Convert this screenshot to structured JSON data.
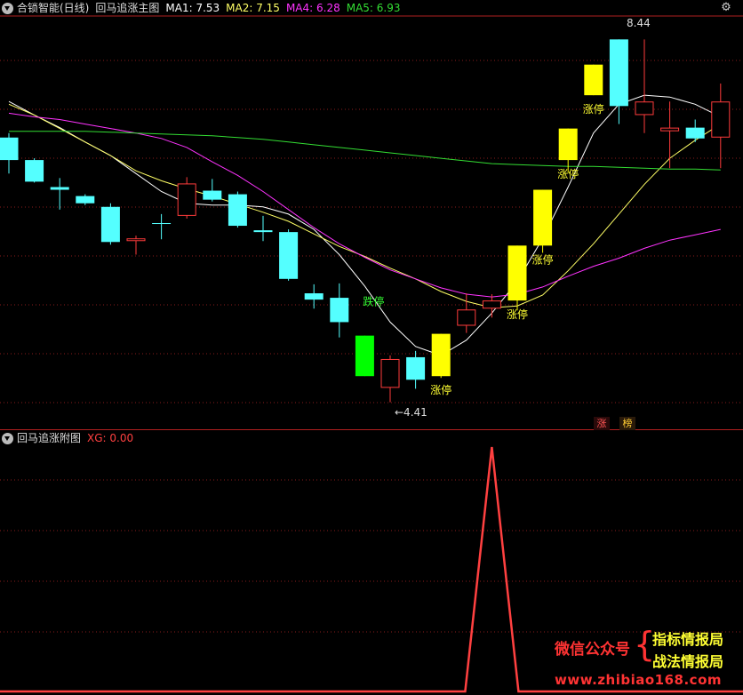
{
  "main_header": {
    "title": "合锁智能(日线)",
    "indicator_name": "回马追涨主图",
    "ma1_label": "MA1: 7.53",
    "ma2_label": "MA2: 7.15",
    "ma4_label": "MA4: 6.28",
    "ma5_label": "MA5: 6.93"
  },
  "sub_header": {
    "indicator_name": "回马追涨附图",
    "xg_label": "XG: 0.00"
  },
  "badges": {
    "zhang": "涨",
    "bang": "榜"
  },
  "watermark": {
    "wechat": "微信公众号",
    "brace": "{",
    "line1": "指标情报局",
    "line2": "战法情报局",
    "site": "www.zhibiao168.com"
  },
  "icons": {
    "settings": "gear-icon",
    "collapse": "chevron-down-icon"
  },
  "colors": {
    "up": "#ff3b3b",
    "down": "#54ffff",
    "limit_up": "#ffff00",
    "limit_down": "#00ff00",
    "ma1": "#ffffff",
    "ma2": "#ffff66",
    "ma4": "#ff33ff",
    "ma5": "#33dd33",
    "grid": "#8a1c1c",
    "xg": "#ff4040"
  },
  "chart_data": [
    {
      "type": "candlestick",
      "title": "回马追涨主图",
      "ylim": [
        4.1,
        8.7
      ],
      "max_label": "8.44",
      "min_label": "←4.41",
      "candles": [
        {
          "o": 7.35,
          "h": 7.4,
          "l": 6.95,
          "c": 7.1,
          "kind": "down"
        },
        {
          "o": 7.1,
          "h": 7.12,
          "l": 6.85,
          "c": 6.86,
          "kind": "down"
        },
        {
          "o": 6.8,
          "h": 6.9,
          "l": 6.55,
          "c": 6.77,
          "kind": "down"
        },
        {
          "o": 6.7,
          "h": 6.72,
          "l": 6.6,
          "c": 6.62,
          "kind": "down"
        },
        {
          "o": 6.58,
          "h": 6.62,
          "l": 6.16,
          "c": 6.19,
          "kind": "down"
        },
        {
          "o": 6.2,
          "h": 6.26,
          "l": 6.05,
          "c": 6.23,
          "kind": "up"
        },
        {
          "o": 6.4,
          "h": 6.5,
          "l": 6.22,
          "c": 6.39,
          "kind": "down"
        },
        {
          "o": 6.48,
          "h": 6.91,
          "l": 6.45,
          "c": 6.84,
          "kind": "up"
        },
        {
          "o": 6.76,
          "h": 6.89,
          "l": 6.64,
          "c": 6.66,
          "kind": "down"
        },
        {
          "o": 6.72,
          "h": 6.75,
          "l": 6.35,
          "c": 6.37,
          "kind": "down"
        },
        {
          "o": 6.32,
          "h": 6.48,
          "l": 6.2,
          "c": 6.3,
          "kind": "down"
        },
        {
          "o": 6.3,
          "h": 6.33,
          "l": 5.76,
          "c": 5.78,
          "kind": "down"
        },
        {
          "o": 5.62,
          "h": 5.72,
          "l": 5.45,
          "c": 5.55,
          "kind": "down"
        },
        {
          "o": 5.57,
          "h": 5.73,
          "l": 5.13,
          "c": 5.3,
          "kind": "down"
        },
        {
          "o": 5.15,
          "h": 5.15,
          "l": 4.7,
          "c": 4.7,
          "kind": "limit_down",
          "label": "跌停"
        },
        {
          "o": 4.89,
          "h": 4.93,
          "l": 4.41,
          "c": 4.57,
          "kind": "up"
        },
        {
          "o": 4.66,
          "h": 4.98,
          "l": 4.56,
          "c": 4.91,
          "kind": "down"
        },
        {
          "o": 4.7,
          "h": 5.17,
          "l": 4.68,
          "c": 5.17,
          "kind": "limit_up",
          "label": "涨停"
        },
        {
          "o": 5.26,
          "h": 5.62,
          "l": 5.18,
          "c": 5.44,
          "kind": "up"
        },
        {
          "o": 5.45,
          "h": 5.61,
          "l": 5.35,
          "c": 5.54,
          "kind": "up"
        },
        {
          "o": 5.54,
          "h": 6.15,
          "l": 5.43,
          "c": 6.15,
          "kind": "limit_up",
          "label": "涨停"
        },
        {
          "o": 6.15,
          "h": 6.77,
          "l": 6.07,
          "c": 6.77,
          "kind": "limit_up",
          "label": "涨停"
        },
        {
          "o": 7.1,
          "h": 7.45,
          "l": 6.96,
          "c": 7.45,
          "kind": "limit_up",
          "label": "涨停"
        },
        {
          "o": 7.82,
          "h": 8.16,
          "l": 7.82,
          "c": 8.16,
          "kind": "limit_up",
          "label": "涨停"
        },
        {
          "o": 8.44,
          "h": 8.44,
          "l": 7.5,
          "c": 7.7,
          "kind": "down"
        },
        {
          "o": 7.6,
          "h": 8.44,
          "l": 7.4,
          "c": 7.75,
          "kind": "up"
        },
        {
          "o": 7.42,
          "h": 7.75,
          "l": 7.01,
          "c": 7.46,
          "kind": "up"
        },
        {
          "o": 7.46,
          "h": 7.55,
          "l": 7.3,
          "c": 7.34,
          "kind": "down"
        },
        {
          "o": 7.35,
          "h": 7.95,
          "l": 7.01,
          "c": 7.75,
          "kind": "up"
        }
      ],
      "ma_series": [
        {
          "name": "MA1",
          "color_key": "ma1",
          "values": [
            7.75,
            7.6,
            7.46,
            7.3,
            7.15,
            6.95,
            6.75,
            6.62,
            6.6,
            6.6,
            6.58,
            6.5,
            6.33,
            6.05,
            5.7,
            5.3,
            5.03,
            4.93,
            5.1,
            5.4,
            5.75,
            6.23,
            6.8,
            7.4,
            7.72,
            7.82,
            7.8,
            7.72,
            7.58
          ]
        },
        {
          "name": "MA2",
          "color_key": "ma2",
          "values": [
            7.72,
            7.6,
            7.45,
            7.3,
            7.15,
            6.98,
            6.87,
            6.78,
            6.7,
            6.61,
            6.52,
            6.42,
            6.28,
            6.14,
            6.03,
            5.9,
            5.78,
            5.64,
            5.53,
            5.46,
            5.48,
            5.6,
            5.87,
            6.17,
            6.5,
            6.83,
            7.12,
            7.32,
            7.5
          ]
        },
        {
          "name": "MA4",
          "color_key": "ma4",
          "values": [
            7.62,
            7.58,
            7.55,
            7.5,
            7.45,
            7.4,
            7.34,
            7.24,
            7.08,
            6.93,
            6.75,
            6.55,
            6.35,
            6.17,
            6.02,
            5.88,
            5.78,
            5.68,
            5.61,
            5.58,
            5.61,
            5.69,
            5.81,
            5.92,
            6.01,
            6.12,
            6.21,
            6.27,
            6.33
          ]
        },
        {
          "name": "MA5",
          "color_key": "ma5",
          "values": [
            7.42,
            7.42,
            7.42,
            7.42,
            7.41,
            7.4,
            7.39,
            7.38,
            7.37,
            7.35,
            7.33,
            7.3,
            7.27,
            7.24,
            7.21,
            7.18,
            7.15,
            7.12,
            7.09,
            7.06,
            7.05,
            7.04,
            7.03,
            7.03,
            7.02,
            7.01,
            7.0,
            7.0,
            6.99
          ]
        }
      ]
    },
    {
      "type": "line",
      "title": "回马追涨附图",
      "series": [
        {
          "name": "XG",
          "values": [
            0,
            0,
            0,
            0,
            0,
            0,
            0,
            0,
            0,
            0,
            0,
            0,
            0,
            0,
            0,
            0,
            0,
            0,
            0,
            1,
            0,
            0,
            0,
            0,
            0,
            0,
            0,
            0,
            0
          ]
        }
      ],
      "ylim": [
        0,
        1
      ]
    }
  ]
}
